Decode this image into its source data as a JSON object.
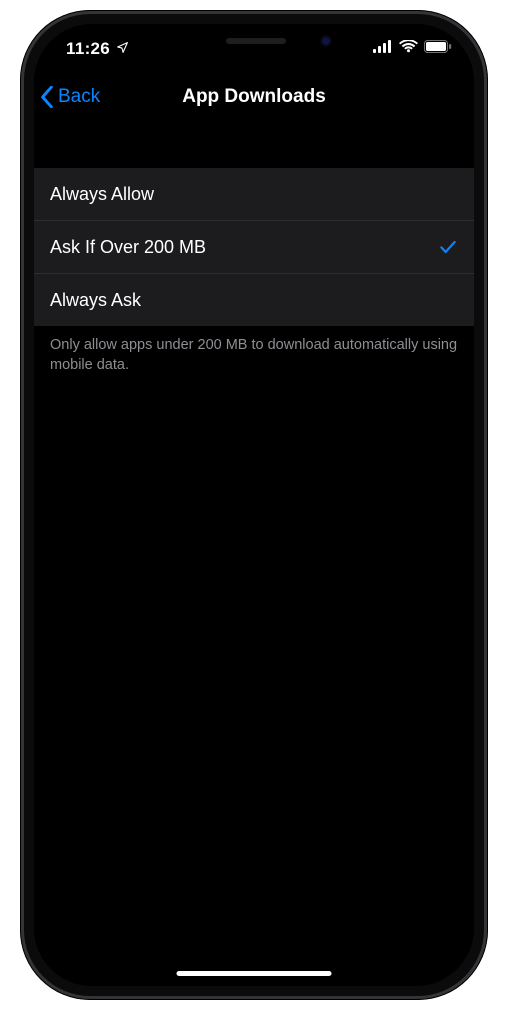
{
  "status": {
    "time": "11:26",
    "location_arrow": "➤"
  },
  "nav": {
    "back_label": "Back",
    "title": "App Downloads"
  },
  "options": {
    "items": [
      {
        "label": "Always Allow",
        "selected": false
      },
      {
        "label": "Ask If Over 200 MB",
        "selected": true
      },
      {
        "label": "Always Ask",
        "selected": false
      }
    ],
    "footer": "Only allow apps under 200 MB to download automatically using mobile data."
  },
  "colors": {
    "accent": "#0a84ff",
    "cell_bg": "#1c1c1e",
    "note": "#8e8e93"
  }
}
